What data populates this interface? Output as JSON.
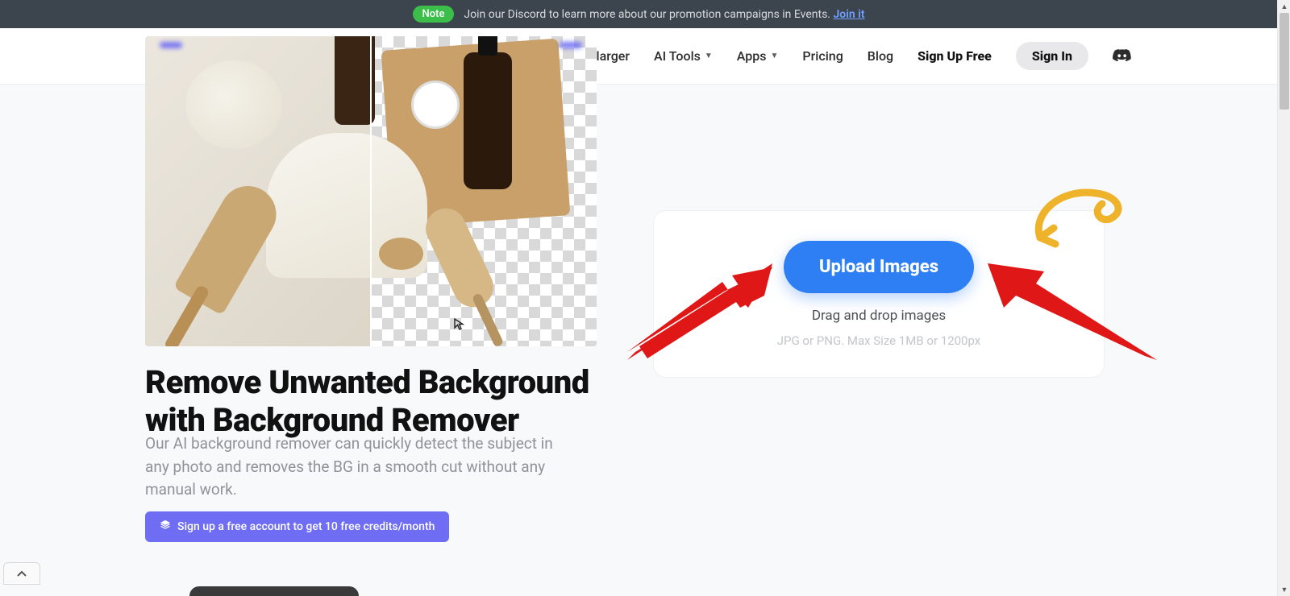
{
  "announce": {
    "note": "Note",
    "text": "Join our Discord to learn more about our promotion campaigns in Events.",
    "link": "Join it"
  },
  "brand": "AI. Image Enlarger",
  "nav": {
    "image_enlarger": "Image Enlarger",
    "ai_tools": "AI Tools",
    "apps": "Apps",
    "pricing": "Pricing",
    "blog": "Blog",
    "signup_free": "Sign Up Free",
    "sign_in": "Sign In"
  },
  "hero": {
    "headline": "Remove Unwanted Background with Background Remover",
    "subtext": "Our AI background remover can quickly detect the subject in any photo and removes the BG in a smooth cut without any manual work.",
    "cta": "Sign up a free account to get 10 free credits/month"
  },
  "upload": {
    "button": "Upload Images",
    "drag": "Drag and drop images",
    "limits": "JPG or PNG. Max Size 1MB or 1200px"
  }
}
